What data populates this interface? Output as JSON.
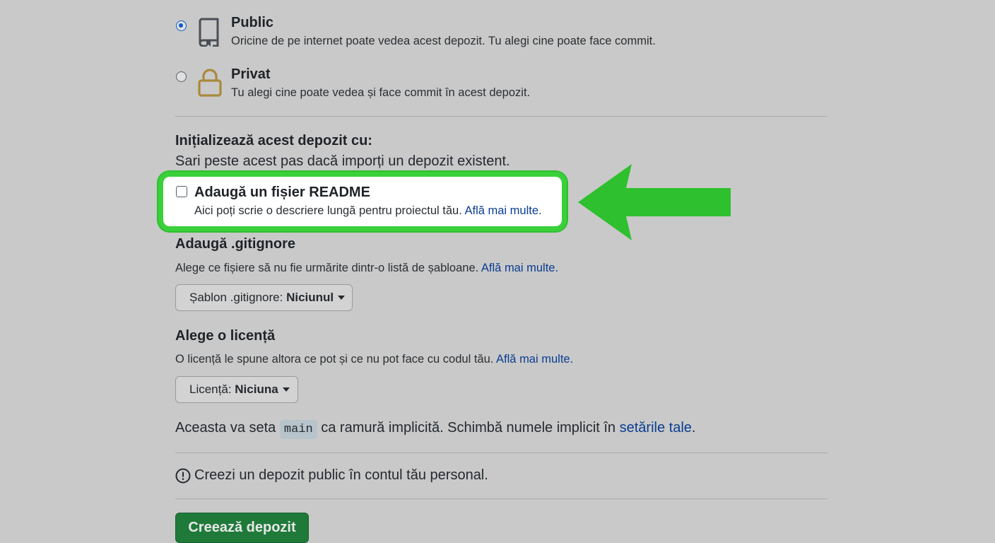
{
  "visibility": {
    "public": {
      "title": "Public",
      "description": "Oricine de pe internet poate vedea acest depozit. Tu alegi cine poate face commit.",
      "selected": true,
      "icon": "repo-icon"
    },
    "private": {
      "title": "Privat",
      "description": "Tu alegi cine poate vedea și face commit în acest depozit.",
      "selected": false,
      "icon": "lock-icon"
    }
  },
  "initialize": {
    "title": "Inițializează acest depozit cu:",
    "subtitle": "Sari peste acest pas dacă imporți un depozit existent."
  },
  "readme": {
    "label": "Adaugă un fișier README",
    "description": "Aici poți scrie o descriere lungă pentru proiectul tău.",
    "link": "Află mai multe.",
    "checked": false
  },
  "gitignore": {
    "title": "Adaugă .gitignore",
    "description": "Alege ce fișiere să nu fie urmărite dintr-o listă de șabloane.",
    "link": "Află mai multe.",
    "dropdown_label": "Șablon .gitignore:",
    "dropdown_value": "Niciunul"
  },
  "license": {
    "title": "Alege o licență",
    "description": "O licență le spune altora ce pot și ce nu pot face cu codul tău.",
    "link": "Află mai multe.",
    "dropdown_label": "Licență:",
    "dropdown_value": "Niciuna"
  },
  "branch": {
    "prefix": "Aceasta va seta",
    "branch_name": "main",
    "middle": "ca ramură implicită. Schimbă numele implicit în",
    "link": "setările tale",
    "suffix": "."
  },
  "notice": {
    "text": "Creezi un depozit public în contul tău personal.",
    "icon": "info-icon"
  },
  "create_button": "Creează depozit",
  "annotation": {
    "arrow_color": "#2ec02e",
    "highlight_color": "#3ad03a"
  }
}
